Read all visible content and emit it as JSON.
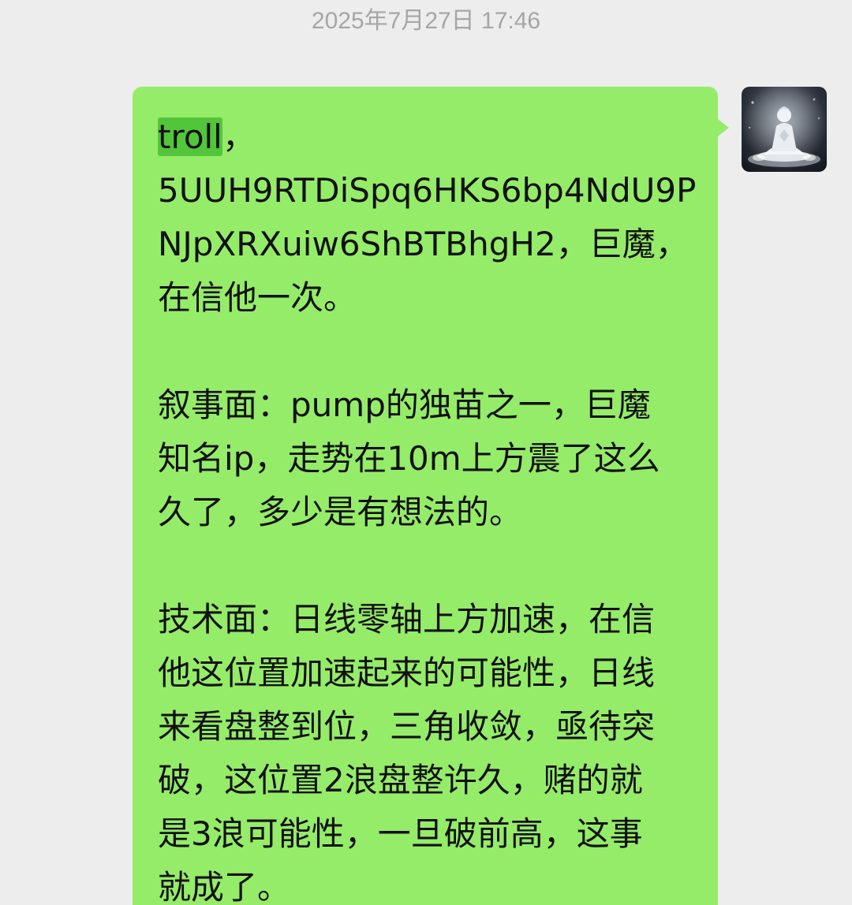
{
  "chat": {
    "timestamp": "2025年7月27日 17:46",
    "message": {
      "highlighted_word": "troll",
      "line1_rest": "，",
      "lines_part1": [
        "5UUH9RTDiSpq6HKS6bp4NdU9P",
        "NJpXRXuiw6ShBTBhgH2，巨魔，",
        "在信他一次。"
      ],
      "lines_part2": [
        "叙事面：pump的独苗之一，巨魔",
        "知名ip，走势在10m上方震了这么",
        "久了，多少是有想法的。"
      ],
      "lines_part3": [
        "技术面：日线零轴上方加速，在信",
        "他这位置加速起来的可能性，日线",
        "来看盘整到位，三角收敛，亟待突",
        "破，这位置2浪盘整许久，赌的就",
        "是3浪可能性，一旦破前高，这事",
        "就成了。"
      ]
    },
    "avatar": {
      "icon": "meditating-figure-avatar"
    }
  },
  "colors": {
    "background": "#ededed",
    "bubble": "#95ec69",
    "highlight": "#53c53b",
    "timestamp": "#a6a6a6",
    "text": "#111111"
  }
}
